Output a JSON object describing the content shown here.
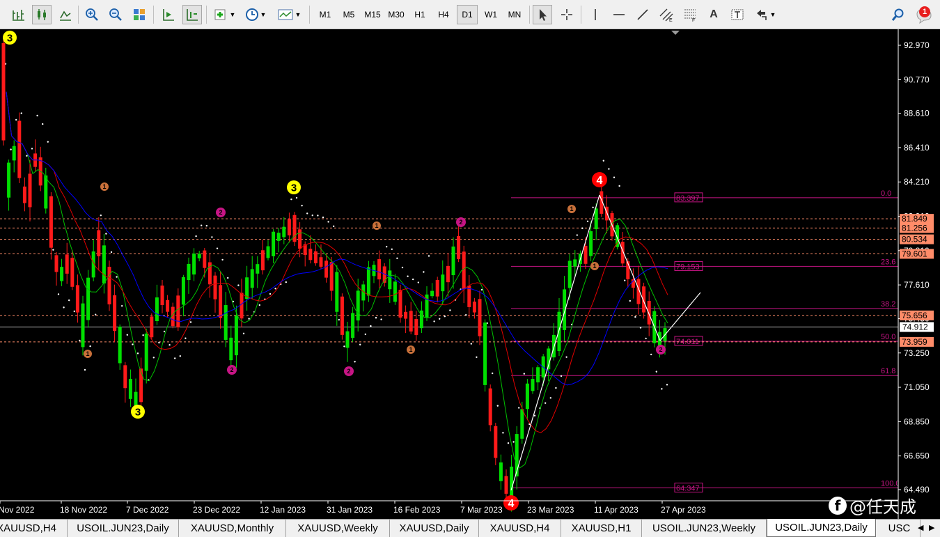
{
  "toolbar": {
    "timeframes": [
      "M1",
      "M5",
      "M15",
      "M30",
      "H1",
      "H4",
      "D1",
      "W1",
      "MN"
    ],
    "active_timeframe": "D1",
    "notification_count": "1",
    "text_tool_label": "A",
    "icons": [
      "bar-chart-icon",
      "candlestick-icon",
      "line-chart-icon",
      "zoom-in-icon",
      "zoom-out-icon",
      "tile-windows-icon",
      "autoscroll-icon",
      "chart-shift-icon",
      "add-indicator-icon",
      "periods-icon",
      "templates-icon",
      "cursor-icon",
      "crosshair-icon",
      "vertical-line-icon",
      "horizontal-line-icon",
      "trendline-icon",
      "equidistant-channel-icon",
      "fibonacci-icon",
      "text-icon",
      "text-label-icon",
      "arrows-icon",
      "search-icon",
      "notifications-icon"
    ]
  },
  "colors": {
    "background": "#000000",
    "bull": "#00e000",
    "bear": "#ff1a1a",
    "ma_green": "#00c000",
    "ma_red": "#e00000",
    "ma_blue": "#0000ff",
    "fib": "#c71585",
    "level": "#ff8c69"
  },
  "chart_data": {
    "type": "candlestick",
    "symbol": "USOIL.JUN23",
    "timeframe": "Daily",
    "y_ticks": [
      "92.970",
      "90.770",
      "88.610",
      "86.410",
      "84.210",
      "82.010",
      "79.810",
      "77.610",
      "75.450",
      "73.250",
      "71.050",
      "68.850",
      "66.650",
      "64.490"
    ],
    "ylim": [
      63.85,
      94.75
    ],
    "x_ticks": [
      "Nov 2022",
      "18 Nov 2022",
      "7 Dec 2022",
      "23 Dec 2022",
      "12 Jan 2023",
      "31 Jan 2023",
      "16 Feb 2023",
      "7 Mar 2023",
      "23 Mar 2023",
      "11 Apr 2023",
      "27 Apr 2023"
    ],
    "current_price": "74.912",
    "price_labels": [
      {
        "text": "81.849",
        "value": 81.849
      },
      {
        "text": "81.256",
        "value": 81.256
      },
      {
        "text": "80.534",
        "value": 80.534
      },
      {
        "text": "79.601",
        "value": 79.601
      },
      {
        "text": "75.656",
        "value": 75.656
      },
      {
        "text": "73.959",
        "value": 73.959
      }
    ],
    "fib_levels": [
      {
        "ratio": "0.0",
        "value": 83.2,
        "price": "83.397"
      },
      {
        "ratio": "23.6",
        "value": 78.8,
        "price": "79.153"
      },
      {
        "ratio": "38.2",
        "value": 76.1,
        "price": ""
      },
      {
        "ratio": "50.0",
        "value": 74.0,
        "price": "74.011"
      },
      {
        "ratio": "61.8",
        "value": 71.8,
        "price": ""
      },
      {
        "ratio": "100.0",
        "value": 64.6,
        "price": "64.347"
      }
    ],
    "wave_labels": [
      {
        "text": "3",
        "kind": "major-yellow",
        "x": 14,
        "y": 12
      },
      {
        "text": "3",
        "kind": "major-yellow",
        "x": 422,
        "y": 227
      },
      {
        "text": "3",
        "kind": "major-yellow",
        "x": 198,
        "y": 549
      },
      {
        "text": "4",
        "kind": "major-red",
        "x": 861,
        "y": 216
      },
      {
        "text": "4",
        "kind": "major-red",
        "x": 734,
        "y": 680
      },
      {
        "text": "1",
        "kind": "minor-orange",
        "x": 150,
        "y": 226
      },
      {
        "text": "1",
        "kind": "minor-orange",
        "x": 126,
        "y": 466
      },
      {
        "text": "1",
        "kind": "minor-orange",
        "x": 541,
        "y": 282
      },
      {
        "text": "1",
        "kind": "minor-orange",
        "x": 590,
        "y": 460
      },
      {
        "text": "1",
        "kind": "minor-orange",
        "x": 821,
        "y": 258
      },
      {
        "text": "1",
        "kind": "minor-orange",
        "x": 854,
        "y": 340
      },
      {
        "text": "2",
        "kind": "minor-magenta",
        "x": 317,
        "y": 263
      },
      {
        "text": "2",
        "kind": "minor-magenta",
        "x": 333,
        "y": 489
      },
      {
        "text": "2",
        "kind": "minor-magenta",
        "x": 662,
        "y": 277
      },
      {
        "text": "2",
        "kind": "minor-magenta",
        "x": 501,
        "y": 491
      },
      {
        "text": "2",
        "kind": "minor-magenta",
        "x": 949,
        "y": 460
      }
    ]
  },
  "tabs": [
    {
      "label": "XAUUSD,H4"
    },
    {
      "label": "USOIL.JUN23,Daily"
    },
    {
      "label": "XAUUSD,Monthly"
    },
    {
      "label": "XAUUSD,Weekly"
    },
    {
      "label": "XAUUSD,Daily"
    },
    {
      "label": "XAUUSD,H4"
    },
    {
      "label": "XAUUSD,H1"
    },
    {
      "label": "USOIL.JUN23,Weekly"
    },
    {
      "label": "USOIL.JUN23,Daily",
      "active": true
    },
    {
      "label": "USC"
    }
  ],
  "watermark": "@任天成"
}
